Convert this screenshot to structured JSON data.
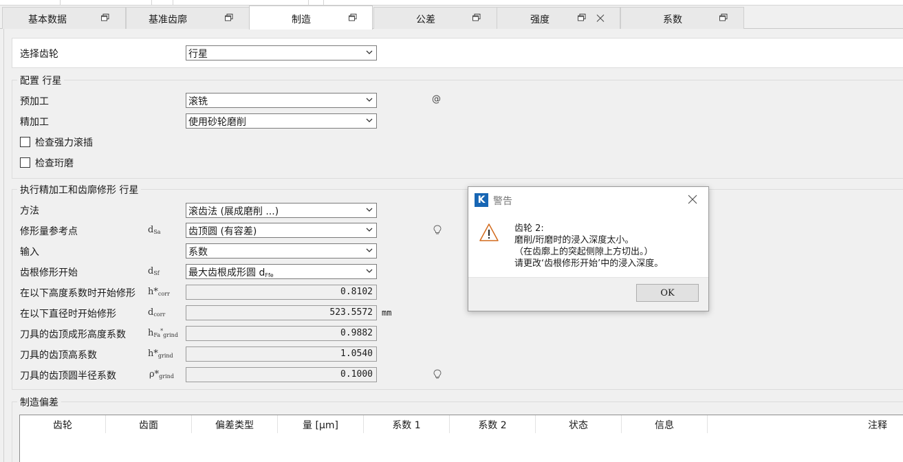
{
  "tabs": [
    {
      "label": "基本数据"
    },
    {
      "label": "基准齿廓"
    },
    {
      "label": "制造"
    },
    {
      "label": "公差"
    },
    {
      "label": "强度"
    },
    {
      "label": "系数"
    }
  ],
  "gear_select": {
    "label": "选择齿轮",
    "value": "行星"
  },
  "config": {
    "title": "配置 行星",
    "pre_machining": {
      "label": "预加工",
      "value": "滚铣",
      "at": "@"
    },
    "finishing": {
      "label": "精加工",
      "value": "使用砂轮磨削"
    },
    "check_power_skiving": "检查强力滚插",
    "check_honing": "检查珩磨"
  },
  "finishing_section": {
    "title": "执行精加工和齿廓修形 行星",
    "rows": {
      "method": {
        "label": "方法",
        "value": "滚齿法 (展成磨削 ...)"
      },
      "ref_point": {
        "label": "修形量参考点",
        "sym": "d",
        "sub": "Sa",
        "value": "齿顶圆 (有容差)"
      },
      "input": {
        "label": "输入",
        "value": "系数"
      },
      "root_start": {
        "label": "齿根修形开始",
        "sym": "d",
        "sub": "Sf",
        "value_main": "最大齿根成形圆 d",
        "value_sub": "Ffe"
      },
      "height_factor": {
        "label": "在以下高度系数时开始修形",
        "sym": "h*",
        "sub": "corr",
        "value": "0.8102"
      },
      "diameter": {
        "label": "在以下直径时开始修形",
        "sym": "d",
        "sub": "corr",
        "value": "523.5572",
        "unit": "mm"
      },
      "tool_form_height": {
        "label": "刀具的齿顶成形高度系数",
        "sym": "h",
        "sub1": "Fa",
        "sup": "*",
        "sub2": "grind",
        "value": "0.9882"
      },
      "tool_addendum": {
        "label": "刀具的齿顶高系数",
        "sym": "h*",
        "sub": "grind",
        "value": "1.0540"
      },
      "tool_tip_radius": {
        "label": "刀具的齿顶圆半径系数",
        "sym": "ρ*",
        "sub": "grind",
        "value": "0.1000"
      }
    }
  },
  "deviation": {
    "title": "制造偏差",
    "columns": [
      "齿轮",
      "齿面",
      "偏差类型",
      "量 [μm]",
      "系数 1",
      "系数 2",
      "状态",
      "信息",
      "注释"
    ]
  },
  "dialog": {
    "title": "警告",
    "logo": "K",
    "lines": [
      "齿轮 2:",
      "磨削/珩磨时的浸入深度太小。",
      "（在齿廓上的突起侧隙上方切出。）",
      "请更改‘齿根修形开始’中的浸入深度。"
    ],
    "ok": "OK"
  }
}
